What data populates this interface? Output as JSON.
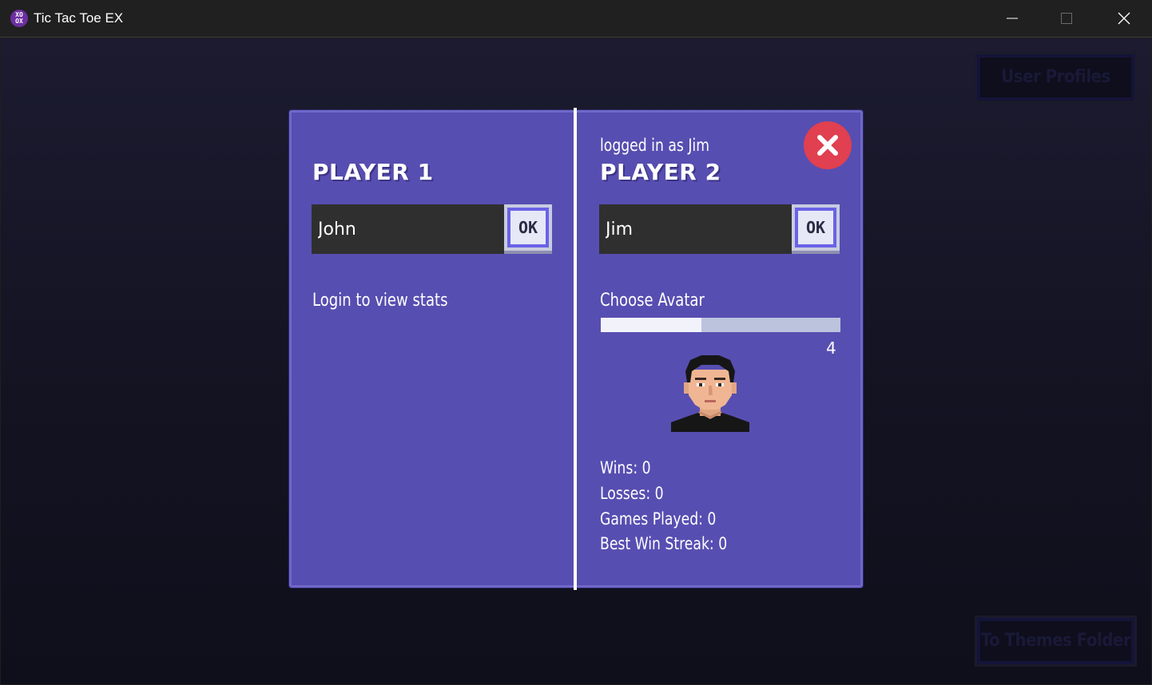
{
  "window": {
    "title": "Tic Tac Toe EX",
    "icon_glyph": "XO\nOX",
    "controls": [
      "minimize-icon",
      "maximize-icon",
      "close-icon"
    ]
  },
  "background_buttons": {
    "user_profiles": "User Profiles",
    "themes_folder": "To Themes Folder"
  },
  "dialog": {
    "player1": {
      "heading": "PLAYER 1",
      "name_value": "John",
      "ok_label": "OK",
      "stats_prompt": "Login to view stats"
    },
    "player2": {
      "logged_in_text": "logged in as Jim",
      "heading": "PLAYER 2",
      "name_value": "Jim",
      "ok_label": "OK",
      "choose_avatar_label": "Choose Avatar",
      "avatar_index": "4",
      "avatar_slider_fraction": 0.42,
      "stats": {
        "wins": "Wins: 0",
        "losses": "Losses: 0",
        "games_played": "Games Played: 0",
        "best_win_streak": "Best Win Streak: 0"
      }
    },
    "close_icon": "x-circle-icon"
  },
  "colors": {
    "panel": "#574eb1",
    "close_button": "#e0404f",
    "ok_border": "#6a62e6"
  }
}
